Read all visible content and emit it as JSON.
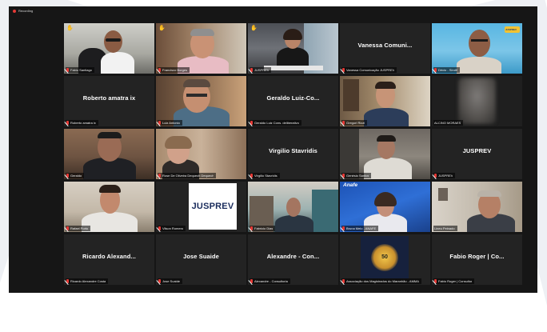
{
  "recording": {
    "label": "Recording"
  },
  "participants": [
    {
      "label": "Fabio Santiago",
      "video": true,
      "hand": true
    },
    {
      "label": "Francisco Borges",
      "video": true,
      "hand": true,
      "active": true
    },
    {
      "label": "JUSPREV",
      "video": true,
      "hand": true
    },
    {
      "label": "Vanessa Comunicação JUSPREV",
      "tile_name": "Vanessa  Comuni...",
      "video": false
    },
    {
      "label": "Décio - Sindif",
      "video": true,
      "badge": "JUSPREV"
    },
    {
      "label": "Roberto amatra ix",
      "tile_name": "Roberto amatra ix",
      "video": false
    },
    {
      "label": "Luiz Antonio",
      "video": true
    },
    {
      "label": "Geraldo Luiz Cons. deliberativo",
      "tile_name": "Geraldo  Luiz-Co...",
      "video": false
    },
    {
      "label": "Gregori Rizzi",
      "video": true
    },
    {
      "label": "ALCINO MORAES",
      "video": true,
      "blurred": true
    },
    {
      "label": "Geraldo",
      "video": true
    },
    {
      "label": "Rose De Oliveira Dequech Dequech",
      "video": true
    },
    {
      "label": "Virgílio Stavridis",
      "tile_name": "Virgilio Stavridis",
      "video": false
    },
    {
      "label": "Genésio Santos",
      "video": true
    },
    {
      "label": "JUSPREV",
      "tile_name": "JUSPREV",
      "video": false
    },
    {
      "label": "Rafael Porto",
      "video": true
    },
    {
      "label": "Vilson Romero",
      "video": true,
      "logo": "JUSPREV"
    },
    {
      "label": "Fabricio Dias",
      "video": true
    },
    {
      "label": "Bruna Melo - ANAFE",
      "video": true,
      "logo": "Anafe"
    },
    {
      "label": "Lineu Peinado",
      "video": true
    },
    {
      "label": "Ricardo Alexandre Costa",
      "tile_name": "Ricardo  Alexand...",
      "video": false
    },
    {
      "label": "Jose Suaide",
      "tile_name": "Jose Suaide",
      "video": false
    },
    {
      "label": "Alexandre - Consultoria",
      "tile_name": "Alexandre  -  Con...",
      "video": false
    },
    {
      "label": "Associação dos Magistrados do Maranhão - AMMA",
      "video": true,
      "logo": "50"
    },
    {
      "label": "Fabio Roger | Consultor",
      "tile_name": "Fabio Roger | Co...",
      "video": false
    }
  ],
  "colors": {
    "app_bg": "#161616",
    "tile_bg": "#232323",
    "active_border": "#b7d542",
    "mic_muted": "#e53935"
  }
}
